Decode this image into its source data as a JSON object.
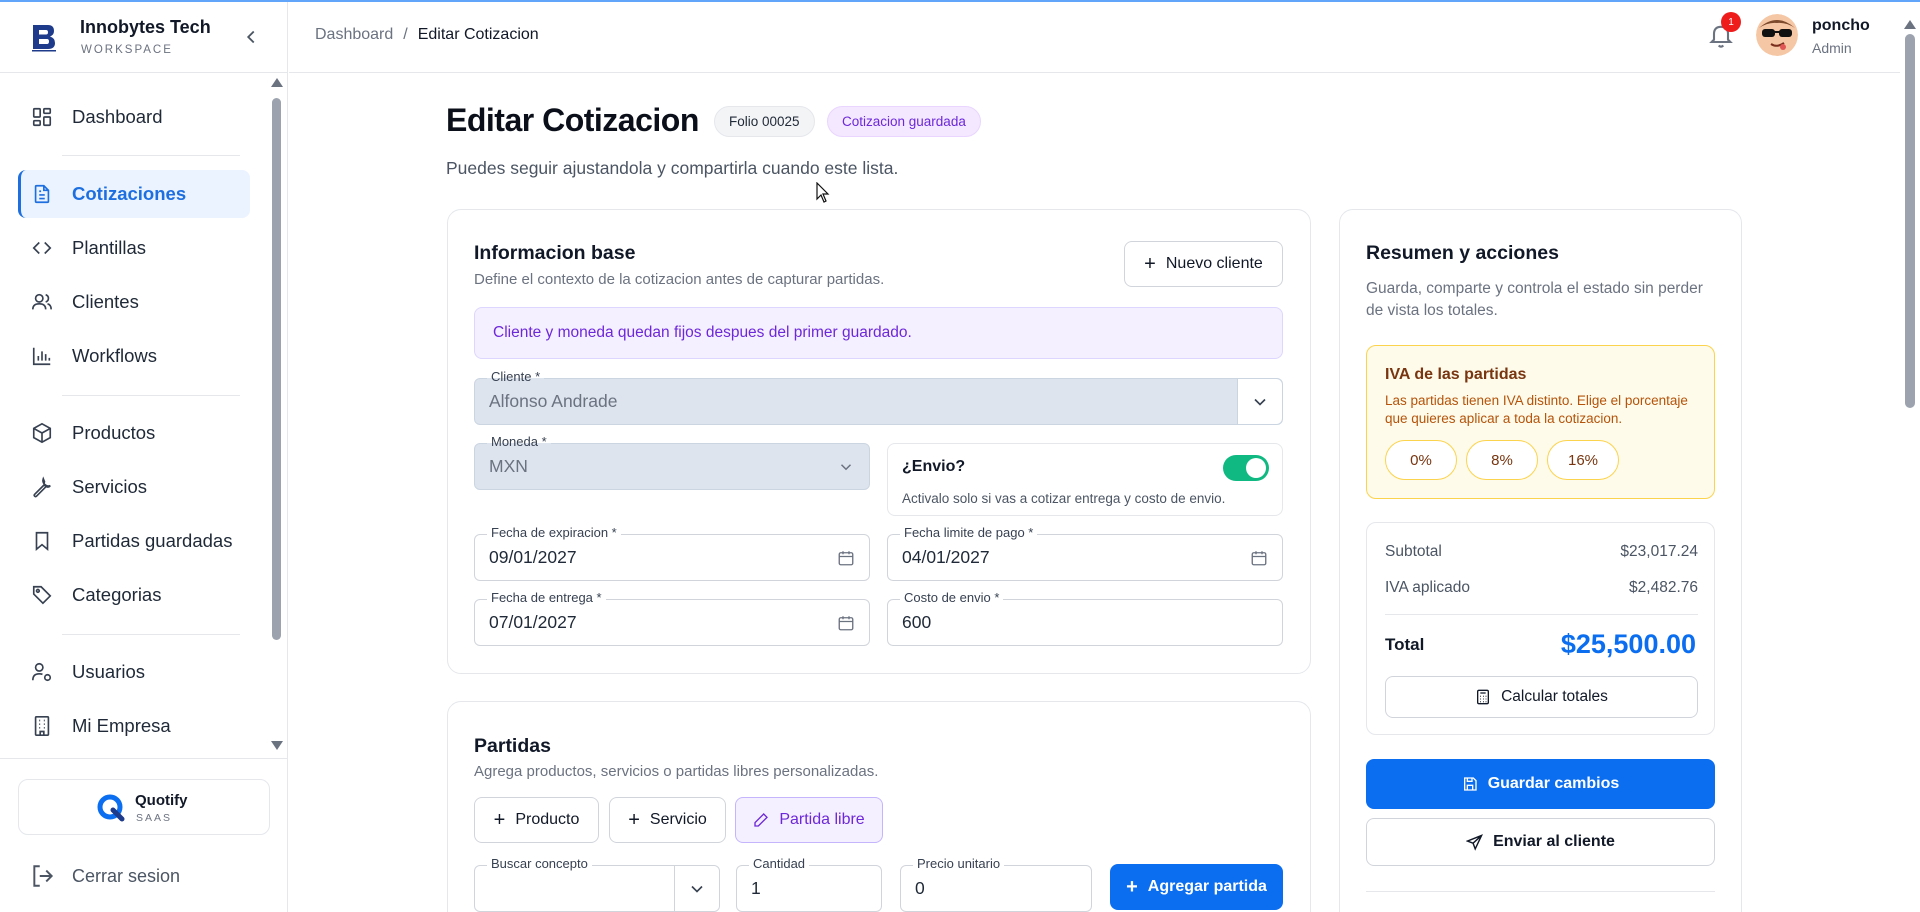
{
  "sidebar": {
    "brand_name": "Innobytes Tech",
    "brand_sub": "WORKSPACE",
    "items": [
      {
        "label": "Dashboard",
        "icon": "grid-icon"
      },
      {
        "label": "Cotizaciones",
        "icon": "document-icon"
      },
      {
        "label": "Plantillas",
        "icon": "code-icon"
      },
      {
        "label": "Clientes",
        "icon": "users-icon"
      },
      {
        "label": "Workflows",
        "icon": "bar-chart-icon"
      },
      {
        "label": "Productos",
        "icon": "package-icon"
      },
      {
        "label": "Servicios",
        "icon": "wrench-icon"
      },
      {
        "label": "Partidas guardadas",
        "icon": "bookmark-icon"
      },
      {
        "label": "Categorias",
        "icon": "tag-icon"
      },
      {
        "label": "Usuarios",
        "icon": "user-gear-icon"
      },
      {
        "label": "Mi Empresa",
        "icon": "building-icon"
      }
    ],
    "product_name": "Quotify",
    "product_sub": "SAAS",
    "logout_label": "Cerrar sesion"
  },
  "header": {
    "breadcrumb_root": "Dashboard",
    "breadcrumb_sep": "/",
    "breadcrumb_current": "Editar Cotizacion",
    "notifications_count": "1",
    "user_name": "poncho",
    "user_role": "Admin"
  },
  "page": {
    "title": "Editar Cotizacion",
    "folio": "Folio 00025",
    "status": "Cotizacion guardada",
    "subtitle": "Puedes seguir ajustandola y compartirla cuando este lista."
  },
  "base_info": {
    "title": "Informacion base",
    "description": "Define el contexto de la cotizacion antes de capturar partidas.",
    "new_client_label": "Nuevo cliente",
    "notice": "Cliente y moneda quedan fijos despues del primer guardado.",
    "cliente_label": "Cliente *",
    "cliente_value": "Alfonso Andrade",
    "moneda_label": "Moneda *",
    "moneda_value": "MXN",
    "envio_title": "¿Envio?",
    "envio_hint": "Activalo solo si vas a cotizar entrega y costo de envio.",
    "envio_enabled": true,
    "fecha_expiracion_label": "Fecha de expiracion *",
    "fecha_expiracion_value": "09/01/2027",
    "fecha_limite_label": "Fecha limite de pago *",
    "fecha_limite_value": "04/01/2027",
    "fecha_entrega_label": "Fecha de entrega *",
    "fecha_entrega_value": "07/01/2027",
    "costo_envio_label": "Costo de envio *",
    "costo_envio_value": "600"
  },
  "partidas": {
    "title": "Partidas",
    "description": "Agrega productos, servicios o partidas libres personalizadas.",
    "tab_producto": "Producto",
    "tab_servicio": "Servicio",
    "tab_libre": "Partida libre",
    "buscar_label": "Buscar concepto",
    "buscar_value": "",
    "cantidad_label": "Cantidad",
    "cantidad_value": "1",
    "precio_label": "Precio unitario",
    "precio_value": "0",
    "add_label": "Agregar partida"
  },
  "summary": {
    "title": "Resumen y acciones",
    "description": "Guarda, comparte y controla el estado sin perder de vista los totales.",
    "iva_title": "IVA de las partidas",
    "iva_desc": "Las partidas tienen IVA distinto. Elige el porcentaje que quieres aplicar a toda la cotizacion.",
    "iva_options": [
      "0%",
      "8%",
      "16%"
    ],
    "subtotal_label": "Subtotal",
    "subtotal_value": "$23,017.24",
    "iva_label": "IVA aplicado",
    "iva_value": "$2,482.76",
    "total_label": "Total",
    "total_value": "$25,500.00",
    "calc_label": "Calcular totales",
    "save_label": "Guardar cambios",
    "send_label": "Enviar al cliente"
  },
  "colors": {
    "primary": "#0b6ef0",
    "active_nav_bg": "#eaf3ff",
    "toggle_on": "#10b981",
    "notice_bg": "#f5f0ff",
    "iva_bg": "#fffbeb"
  }
}
